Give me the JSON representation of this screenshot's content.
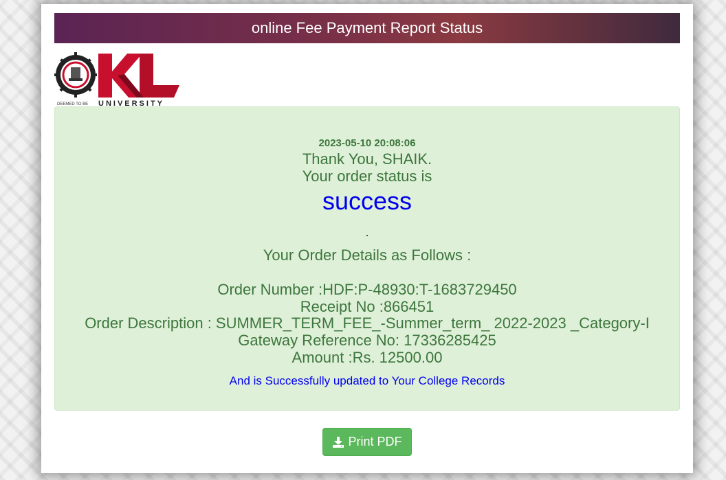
{
  "header": {
    "title": "online Fee Payment Report Status"
  },
  "logo": {
    "main_text": "KL",
    "sub_text": "UNIVERSITY",
    "deemed_text": "DEEMED TO BE"
  },
  "order": {
    "timestamp": "2023-05-10 20:08:06",
    "thank_you": "Thank You, SHAIK.",
    "status_intro": "Your order status is",
    "status": "success",
    "dot": ".",
    "details_heading": "Your Order Details as Follows :",
    "order_number": "Order Number :HDF:P-48930:T-1683729450",
    "receipt_no": "Receipt No :866451",
    "description": "Order Description : SUMMER_TERM_FEE_-Summer_term_ 2022-2023 _Category-I",
    "gateway_ref": "Gateway Reference No: 17336285425",
    "amount": "Amount :Rs. 12500.00",
    "update_note": "And is Successfully updated to Your College Records"
  },
  "actions": {
    "print_label": "Print PDF",
    "print_icon": "download-icon"
  },
  "colors": {
    "header_start": "#5b2454",
    "header_end": "#3f2a3e",
    "panel_bg": "#dff0d8",
    "success_text": "#3c763d",
    "link_blue": "#0000ee",
    "button_green": "#5cb85c",
    "logo_red": "#c8102e"
  }
}
